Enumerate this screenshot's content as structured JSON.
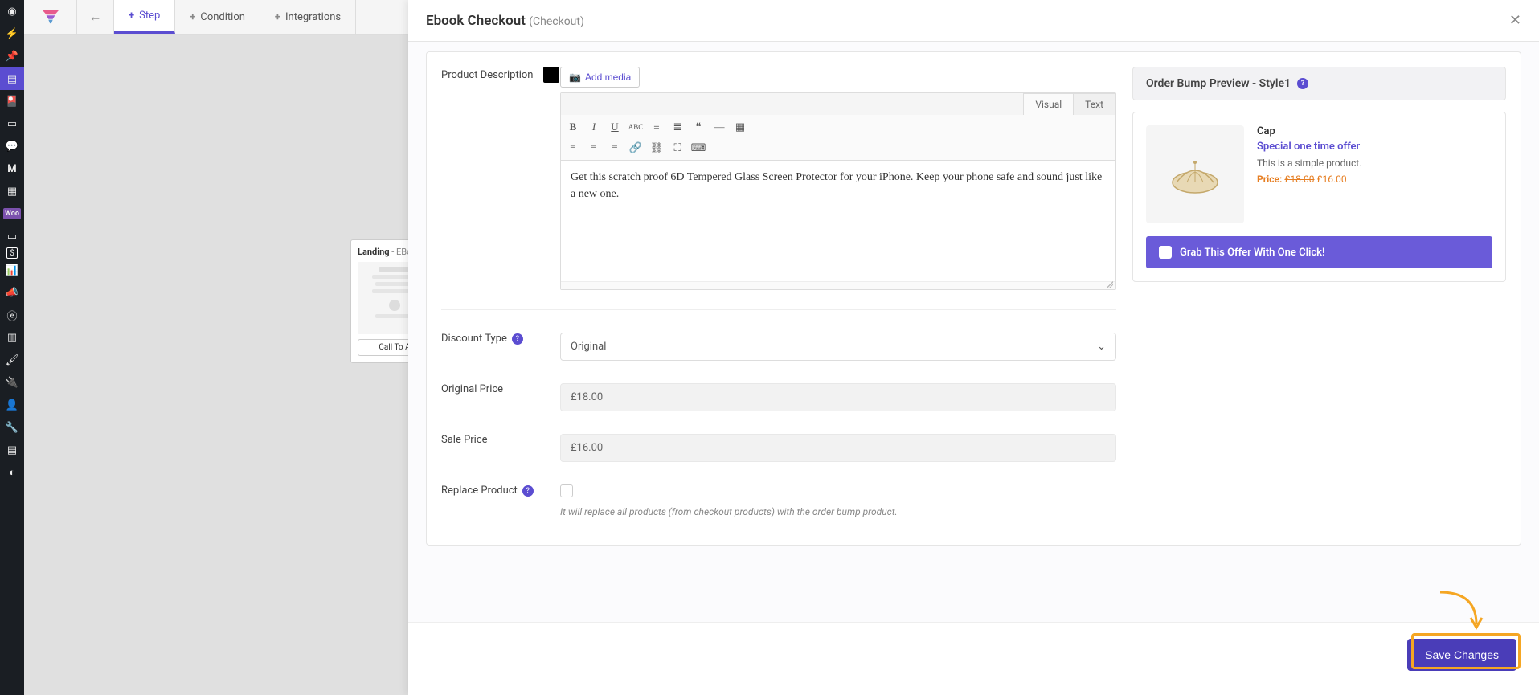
{
  "colors": {
    "accent": "#5b4dd1",
    "highlight": "#f5a623",
    "priceColor": "#e67e22"
  },
  "topbar": {
    "tabs": {
      "step": "Step",
      "condition": "Condition",
      "integrations": "Integrations"
    }
  },
  "landingCard": {
    "titleBold": "Landing",
    "titleRest": " - EBo",
    "cta": "Call To A"
  },
  "modal": {
    "title": "Ebook Checkout",
    "subtitle": "(Checkout)",
    "productDescription": {
      "label": "Product Description",
      "addMedia": "Add media",
      "tabs": {
        "visual": "Visual",
        "text": "Text"
      },
      "content": "Get this scratch proof 6D Tempered Glass Screen Protector for your iPhone. Keep your phone safe and sound just like a new one."
    },
    "discount": {
      "label": "Discount Type",
      "value": "Original"
    },
    "originalPrice": {
      "label": "Original Price",
      "value": "£18.00"
    },
    "salePrice": {
      "label": "Sale Price",
      "value": "£16.00"
    },
    "replaceProduct": {
      "label": "Replace Product",
      "hint": "It will replace all products (from checkout products) with the order bump product."
    },
    "preview": {
      "heading": "Order Bump Preview - Style1",
      "productName": "Cap",
      "offerText": "Special one time offer",
      "description": "This is a simple product.",
      "priceLabel": "Price:",
      "oldPrice": "£18.00",
      "newPrice": "£16.00",
      "grabText": "Grab This Offer With One Click!"
    },
    "saveButton": "Save Changes"
  }
}
